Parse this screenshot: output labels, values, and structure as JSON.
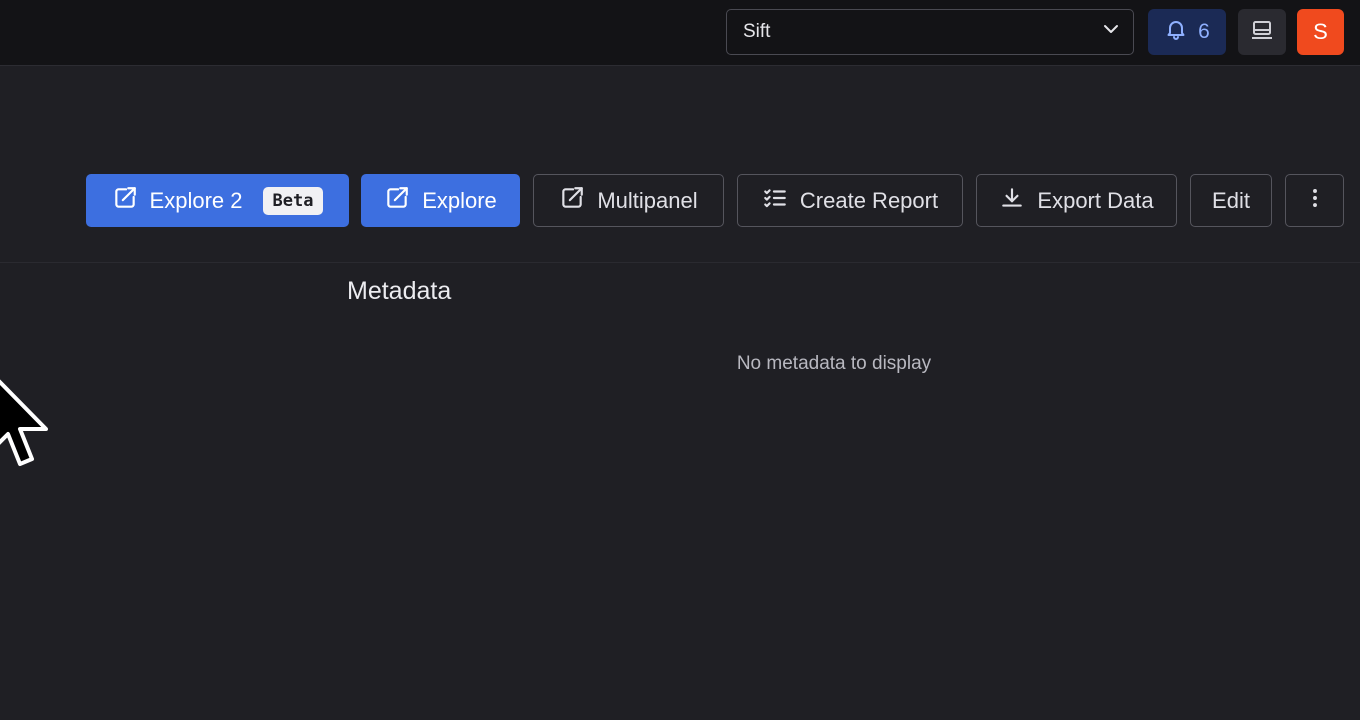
{
  "header": {
    "org_select": {
      "value": "Sift",
      "icon": "chevron-down-icon"
    },
    "notifications": {
      "count": "6",
      "icon": "bell-icon"
    },
    "panel_toggle": {
      "icon": "laptop-icon"
    },
    "avatar": {
      "initial": "S",
      "color": "#f04a1e"
    }
  },
  "toolbar": {
    "explore2": {
      "label": "Explore 2",
      "badge": "Beta",
      "icon": "external-link-icon"
    },
    "explore": {
      "label": "Explore",
      "icon": "external-link-icon"
    },
    "multipanel": {
      "label": "Multipanel",
      "icon": "external-link-icon"
    },
    "create_report": {
      "label": "Create Report",
      "icon": "checklist-icon"
    },
    "export_data": {
      "label": "Export Data",
      "icon": "download-icon"
    },
    "edit": {
      "label": "Edit"
    },
    "more": {
      "icon": "more-vertical-icon"
    }
  },
  "metadata": {
    "title": "Metadata",
    "empty_message": "No metadata to display"
  },
  "colors": {
    "accent": "#3d6fe0",
    "background": "#1f1f24",
    "topbar": "#131316"
  }
}
